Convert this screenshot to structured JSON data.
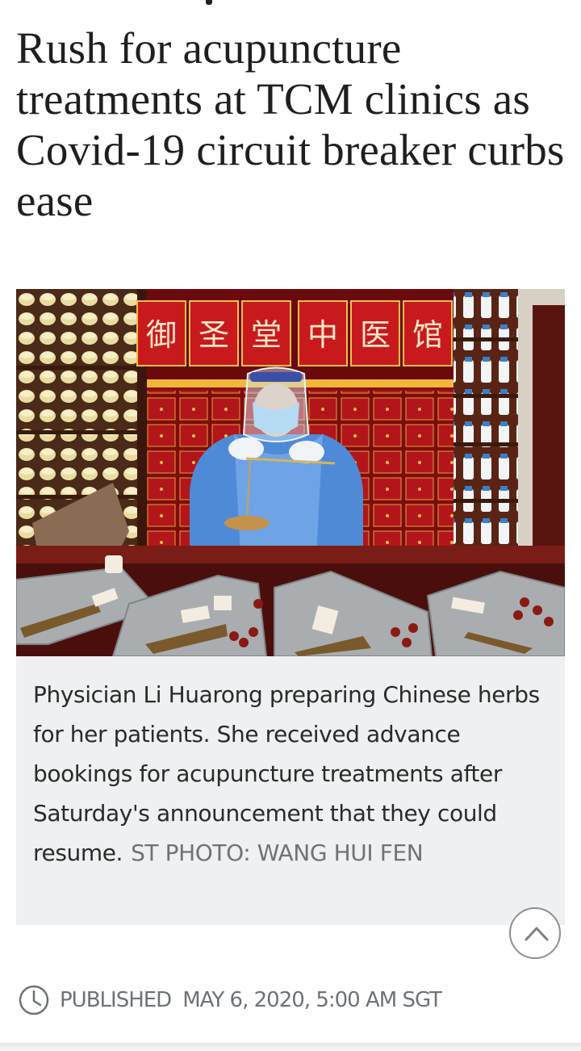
{
  "article": {
    "headline": "Rush for acupuncture treatments at TCM clinics as Covid-19 circuit breaker curbs ease",
    "figure": {
      "photo_signboard": "御 圣 堂 中 医 馆",
      "caption": "Physician Li Huarong preparing Chinese herbs for her patients. She received advance bookings for acupuncture treatments after Saturday's announcement that they could resume.",
      "credit": "ST PHOTO: WANG HUI FEN"
    },
    "published": {
      "label": "PUBLISHED",
      "datetime": "MAY 6, 2020, 5:00 AM SGT"
    }
  },
  "icons": {
    "scroll_top": "chevron-up-icon",
    "clock": "clock-icon"
  },
  "colors": {
    "caption_bg": "#eef0f1",
    "meta_gray": "#6d7276",
    "headline": "#1f1f1f"
  }
}
